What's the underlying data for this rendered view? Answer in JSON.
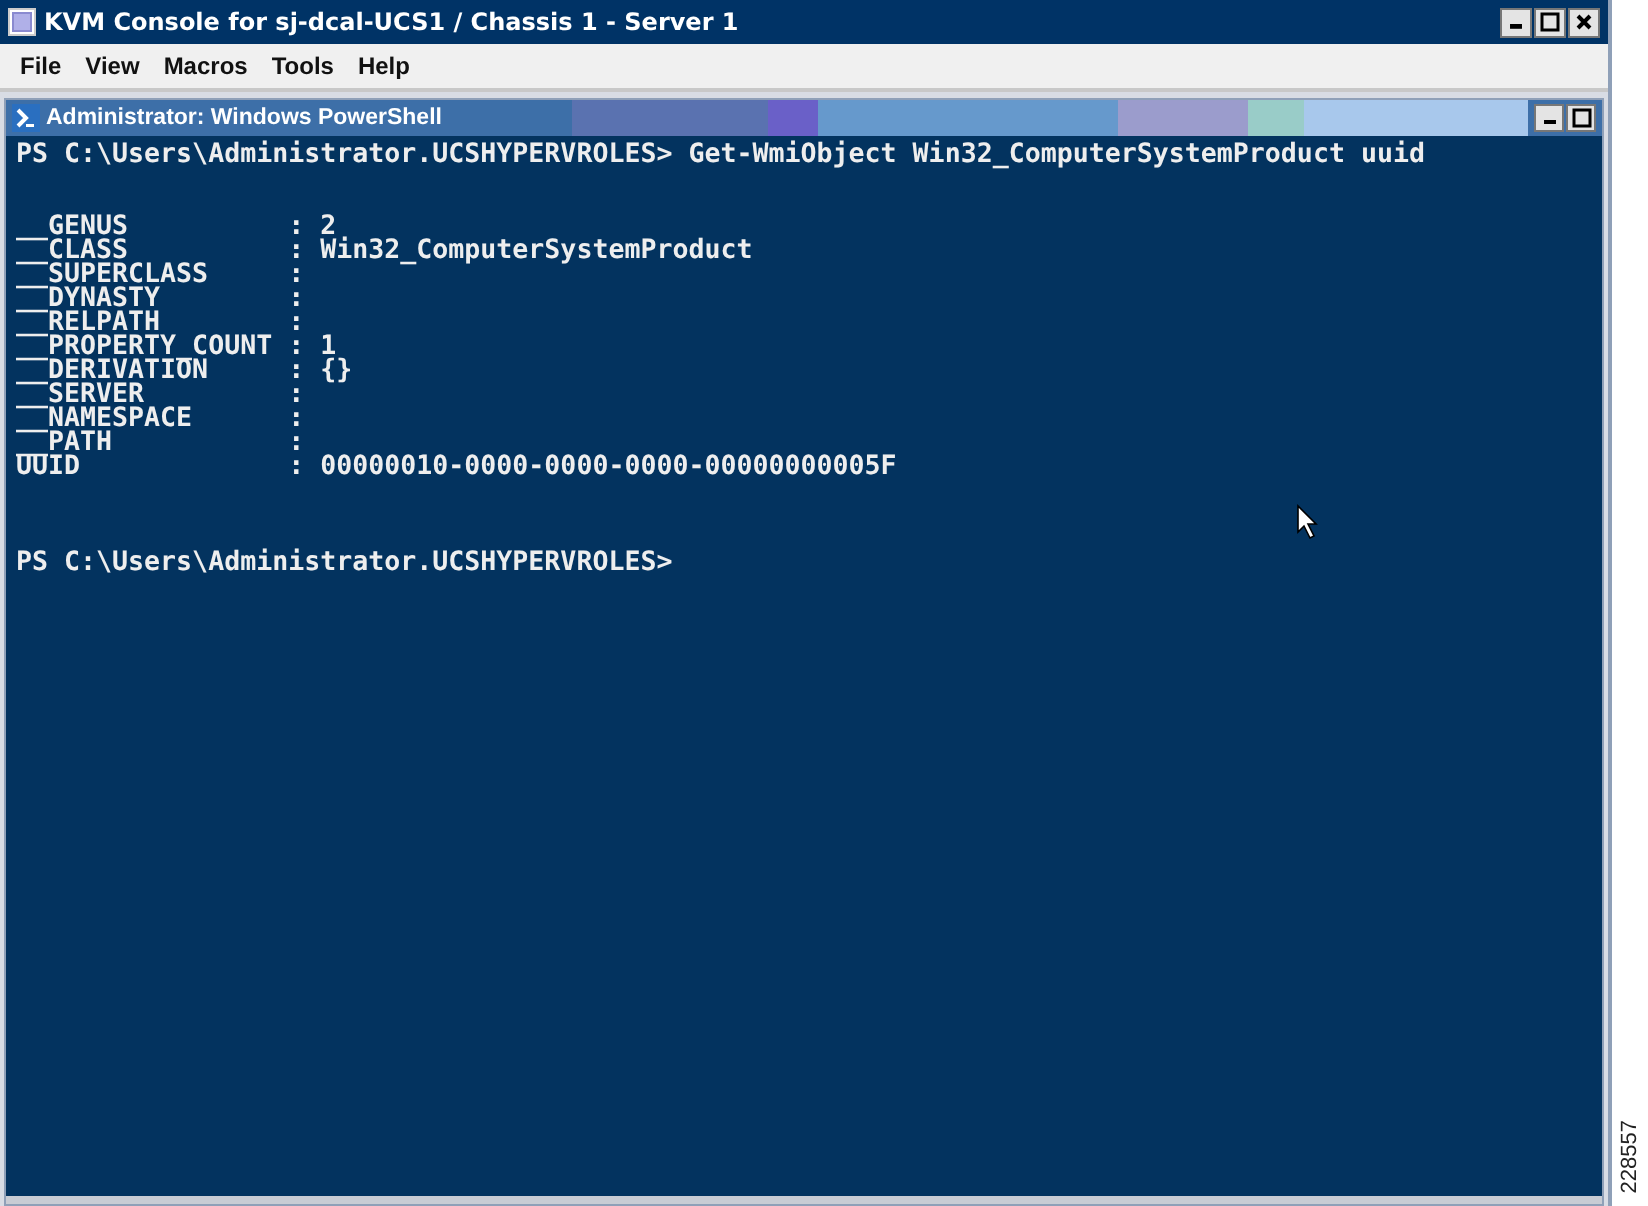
{
  "window": {
    "title": "KVM Console for sj-dcal-UCS1 / Chassis 1 - Server 1"
  },
  "menu": [
    "File",
    "View",
    "Macros",
    "Tools",
    "Help"
  ],
  "inner_window": {
    "title": "Administrator: Windows PowerShell"
  },
  "console": {
    "blocks": [
      {
        "kind": "command",
        "lines": [
          "PS C:\\Users\\Administrator.UCSHYPERVROLES> Get-WmiObject Win32_ComputerSystemProduct uuid"
        ]
      },
      {
        "kind": "output",
        "lines": [
          "__GENUS          : 2",
          "__CLASS          : Win32_ComputerSystemProduct",
          "__SUPERCLASS     :",
          "__DYNASTY        :",
          "__RELPATH        :",
          "__PROPERTY_COUNT : 1",
          "__DERIVATION     : {}",
          "__SERVER         :",
          "__NAMESPACE      :",
          "__PATH           :",
          "UUID             : 00000010-0000-0000-0000-00000000005F"
        ]
      },
      {
        "kind": "prompt",
        "lines": [
          "PS C:\\Users\\Administrator.UCSHYPERVROLES>"
        ]
      }
    ]
  },
  "figure_id": "228557"
}
